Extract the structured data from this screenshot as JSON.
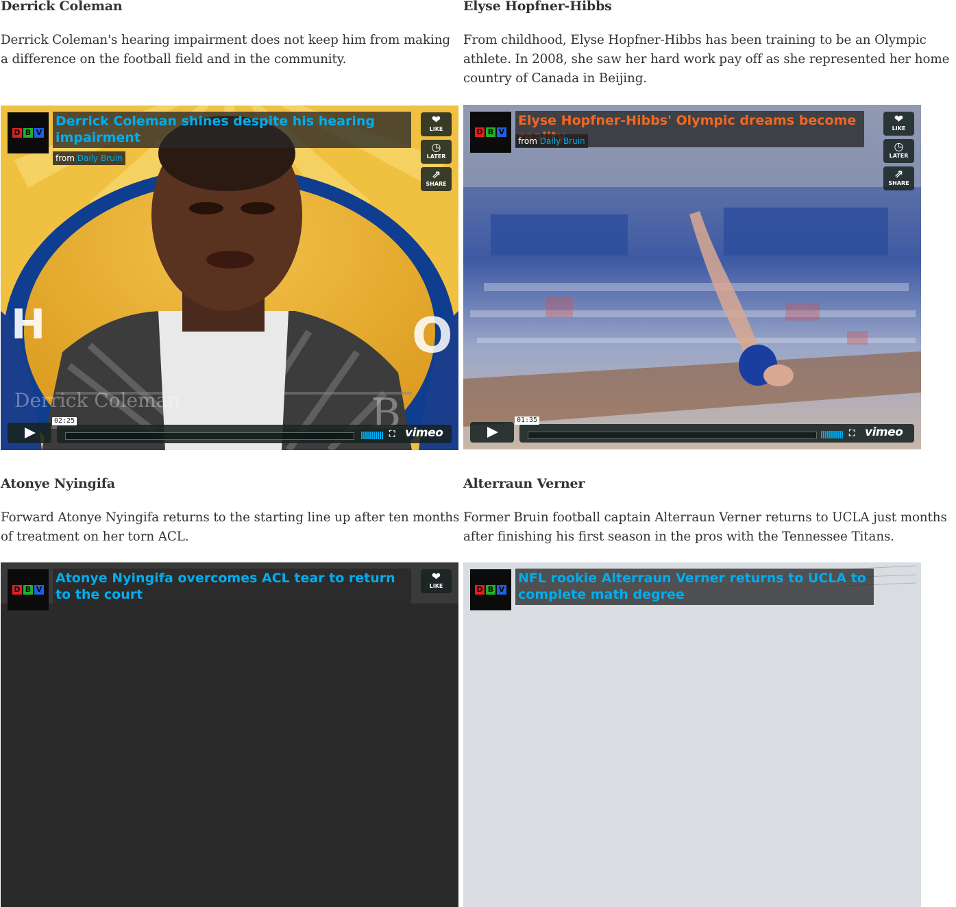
{
  "videos": [
    {
      "name": "Derrick Coleman",
      "description": "Derrick Coleman's hearing impairment does not keep him from making a difference on the football field and in the community.",
      "video_title": "Derrick Coleman shines despite his hearing impairment",
      "title_color": "#00adef",
      "from_label": "from",
      "from_link": "Daily Bruin",
      "like_label": "LIKE",
      "later_label": "LATER",
      "share_label": "SHARE",
      "duration": "02:25",
      "vimeo_label": "vimeo",
      "overlay_text": "Derrick Coleman"
    },
    {
      "name": "Elyse Hopfner-Hibbs",
      "description": "From childhood, Elyse Hopfner-Hibbs has been training to be an Olympic athlete. In 2008, she saw her hard work pay off as she represented her home country of Canada in Beijing.",
      "video_title": "Elyse Hopfner-Hibbs' Olympic dreams become reality",
      "title_color": "#f26722",
      "from_label": "from",
      "from_link": "Daily Bruin",
      "like_label": "LIKE",
      "later_label": "LATER",
      "share_label": "SHARE",
      "duration": "01:35",
      "vimeo_label": "vimeo"
    },
    {
      "name": "Atonye Nyingifa",
      "description": "Forward Atonye Nyingifa returns to the starting line up after ten months of treatment on her torn ACL.",
      "video_title": "Atonye Nyingifa overcomes ACL tear to return to the court",
      "title_color": "#00adef",
      "like_label": "LIKE"
    },
    {
      "name": "Alterraun Verner",
      "description": "Former Bruin football captain Alterraun Verner returns to UCLA just months after finishing his first season in the pros with the Tennessee Titans.",
      "video_title": "NFL rookie Alterraun Verner returns to UCLA to complete math degree",
      "title_color": "#00adef"
    }
  ],
  "logo": {
    "letters": [
      "D",
      "B",
      "V"
    ],
    "colors": [
      "#e02020",
      "#22b02a",
      "#2060e0"
    ]
  },
  "icons": {
    "like": "heart-icon",
    "later": "clock-icon",
    "share": "share-icon",
    "play": "play-icon",
    "fullscreen": "fullscreen-icon",
    "volume": "volume-icon"
  }
}
